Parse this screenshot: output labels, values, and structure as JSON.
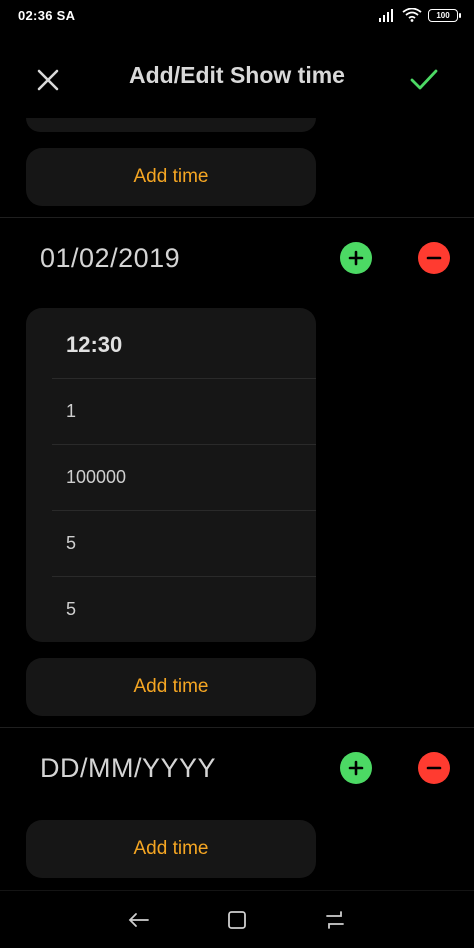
{
  "status_bar": {
    "time": "02:36 SA",
    "battery": "100"
  },
  "app_bar": {
    "title": "Add/Edit Show time"
  },
  "top_section": {
    "add_time_label": "Add time"
  },
  "date_section_1": {
    "date": "01/02/2019",
    "time_card": {
      "time": "12:30",
      "rows": [
        "1",
        "100000",
        "5",
        "5"
      ]
    },
    "add_time_label": "Add time"
  },
  "date_section_2": {
    "date": "DD/MM/YYYY",
    "add_time_label": "Add time"
  },
  "colors": {
    "accent_orange": "#f5a623",
    "add_green": "#4cd964",
    "remove_red": "#ff3b30",
    "check_green": "#4cd964"
  }
}
